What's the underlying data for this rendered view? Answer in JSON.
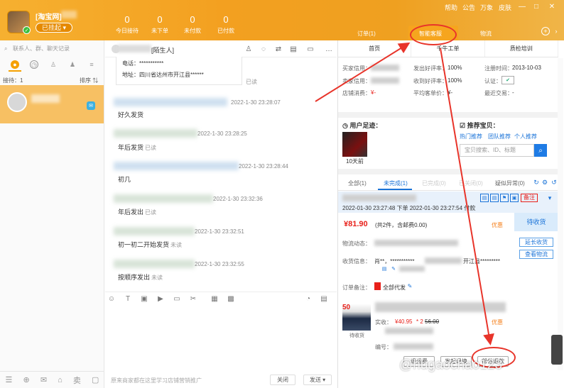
{
  "window": {
    "username": "[淘宝网]",
    "status": "已挂起",
    "links": [
      "帮助",
      "公告",
      "万象",
      "皮肤"
    ],
    "controls": [
      "—",
      "□",
      "✕"
    ]
  },
  "stats": [
    {
      "value": "0",
      "label": "今日接待"
    },
    {
      "value": "0",
      "label": "未下单"
    },
    {
      "value": "0",
      "label": "未付款"
    },
    {
      "value": "0",
      "label": "已付款"
    }
  ],
  "right_tabs": [
    "订单(1)",
    "智能客服",
    "物流"
  ],
  "left": {
    "search_placeholder": "联系人、群、聊天记录",
    "queue": "接待：1",
    "sort": "排序 ⇅"
  },
  "chat": {
    "peer": "[陌生人]",
    "card": {
      "phone_label": "电话：",
      "phone_value": "***********",
      "addr_label": "地址：",
      "addr_value": "四川省达州市开江县******"
    },
    "card_read": "已读",
    "messages": [
      {
        "time": "2022-1-30 23:28:07",
        "text": "好久发货",
        "read": ""
      },
      {
        "time": "2022-1-30 23:28:25",
        "text": "年后发货",
        "read": "已读"
      },
      {
        "time": "2022-1-30 23:28:44",
        "text": "初几",
        "read": ""
      },
      {
        "time": "2022-1-30 23:32:36",
        "text": "年后发出",
        "read": "已读"
      },
      {
        "time": "2022-1-30 23:32:51",
        "text": "初一初二开始发货",
        "read": "未读"
      },
      {
        "time": "2022-1-30 23:32:55",
        "text": "按顺序发出",
        "read": "未读"
      }
    ],
    "ad": "原来商家都在这里学习店铺营销推广",
    "close": "关闭",
    "send": "发送 ▾"
  },
  "right": {
    "subtabs": [
      "首页",
      "千牛工单",
      "质检培训"
    ],
    "info": [
      [
        "买家信用：",
        ""
      ],
      [
        "发出好评率：",
        "100%"
      ],
      [
        "注册时间：",
        "2013-10-03"
      ],
      [
        "卖家信用：",
        ""
      ],
      [
        "收到好评率：",
        "100%"
      ],
      [
        "认证：",
        ""
      ],
      [
        "店铺消费：",
        "¥-"
      ],
      [
        "平均客单价：",
        "¥-"
      ],
      [
        "最近交易：",
        "-"
      ]
    ],
    "footprint_label": "用户足迹：",
    "footprint_days": "10天前",
    "recommend_label": "推荐宝贝：",
    "rec_links": [
      "热门推荐",
      "团队推荐",
      "个人推荐"
    ],
    "rec_search": "宝贝搜索、ID、标题",
    "order_tabs": [
      "全部(1)",
      "未完成(1)",
      "已完成(0)",
      "已关闭(0)",
      "疑似异常(0)"
    ],
    "order": {
      "times": "2022-01-30 23:27:48 下单  2022-01-30 23:27:54 付款",
      "remark_btn": "备注",
      "price": "¥81.90",
      "price_note": "(共2件，含邮费0.00)",
      "discount": "优惠",
      "status": "待收货",
      "logistics_label": "物流动态：",
      "addr_label": "收货信息：",
      "addr_val": "肖**，***********",
      "addr_tail": "开江县*********",
      "remark_label": "订单备注：",
      "remark_val": "全部代发",
      "actions": [
        "延长收货",
        "查看物流"
      ],
      "product": {
        "tag": "50",
        "paid_label": "实收：",
        "paid": "¥40.95",
        "qty": "* 2",
        "orig": "56.00",
        "discount": "优惠",
        "code_label": "编号：",
        "state": "待收货"
      },
      "bottom_btns": [
        "退运费",
        "发起退换",
        "帮他退款"
      ]
    }
  },
  "watermark": "@hugaochao123"
}
